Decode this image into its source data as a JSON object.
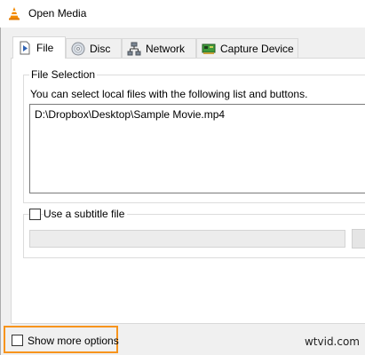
{
  "window": {
    "title": "Open Media",
    "app_icon": "vlc-cone-icon"
  },
  "tabs": [
    {
      "label": "File",
      "icon": "file-play-icon",
      "active": true
    },
    {
      "label": "Disc",
      "icon": "disc-icon",
      "active": false
    },
    {
      "label": "Network",
      "icon": "network-icon",
      "active": false
    },
    {
      "label": "Capture Device",
      "icon": "capture-card-icon",
      "active": false
    }
  ],
  "file_selection": {
    "group_title": "File Selection",
    "hint": "You can select local files with the following list and buttons.",
    "files": [
      "D:\\Dropbox\\Desktop\\Sample Movie.mp4"
    ]
  },
  "subtitle": {
    "label": "Use a subtitle file",
    "checked": false,
    "path_value": ""
  },
  "options": {
    "show_more_label": "Show more options",
    "checked": false
  },
  "watermark": "wtvid.com",
  "colors": {
    "highlight": "#f7941d",
    "dialog_bg": "#f0f0f0"
  }
}
